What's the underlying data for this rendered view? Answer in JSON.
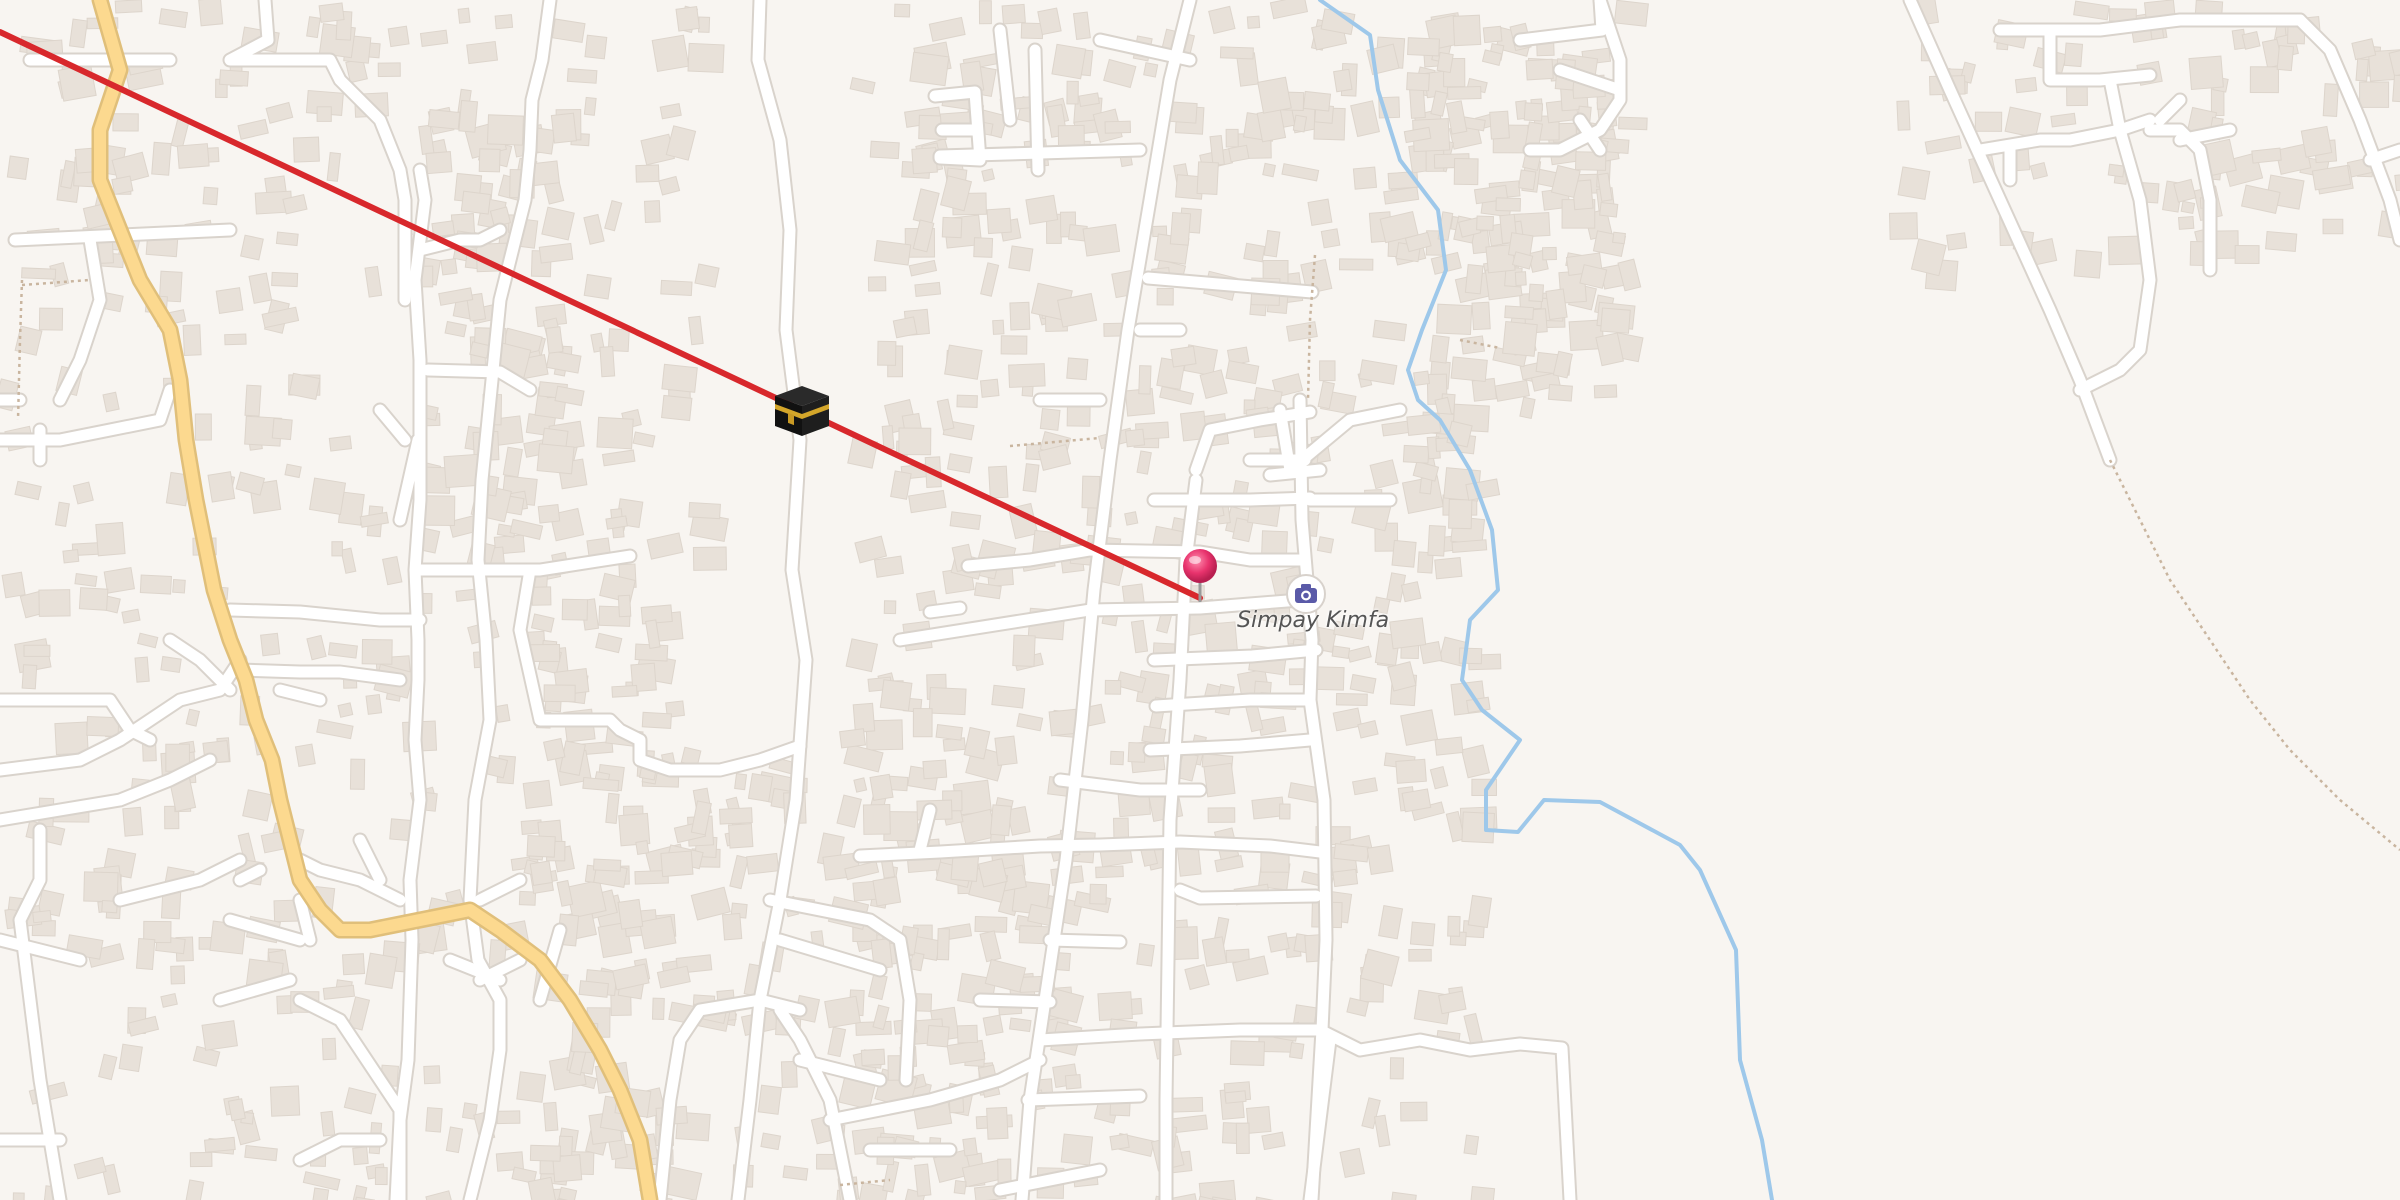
{
  "map": {
    "background_color": "#f8f5f1",
    "road_color": "#ffffff",
    "major_road_color": "#fcd98f",
    "water_color": "#9ec8ea",
    "building_color": "#e8e1d9",
    "direction_line_color": "#d8282c"
  },
  "markers": {
    "kaaba": {
      "icon": "kaaba-icon"
    },
    "location_pin": {
      "icon": "map-pin-icon",
      "color": "#e8336d"
    },
    "poi": {
      "icon": "camera-icon",
      "label": "Simpay Kimfa"
    }
  }
}
